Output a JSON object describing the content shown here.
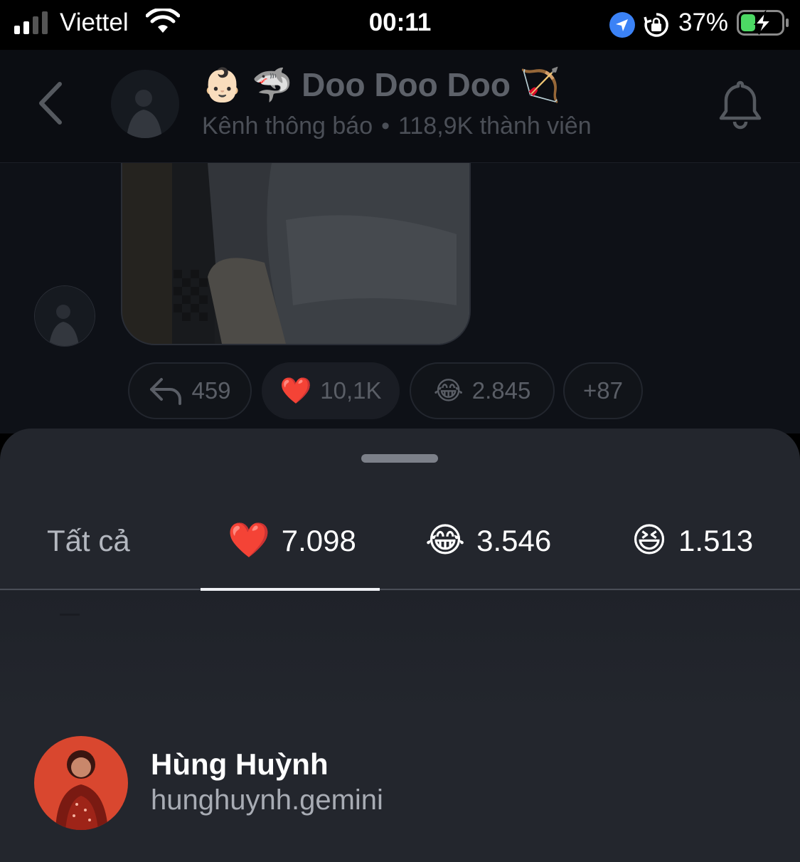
{
  "status_bar": {
    "carrier": "Viettel",
    "time": "00:11",
    "battery_percent": "37%",
    "battery_level": 0.37,
    "charging": true
  },
  "header": {
    "title_emoji_1": "👶🏻",
    "title_emoji_2": "🦈",
    "title_text": "Doo Doo Doo",
    "title_emoji_3": "🏹",
    "subtitle_type": "Kênh thông báo",
    "subtitle_separator": "•",
    "subtitle_members": "118,9K thành viên"
  },
  "message_reactions": [
    {
      "icon": "reply-icon",
      "count": "459"
    },
    {
      "emoji": "❤️",
      "count": "10,1K"
    },
    {
      "emoji": "😂",
      "count": "2.845"
    },
    {
      "count": "+87"
    }
  ],
  "sheet": {
    "tabs": [
      {
        "label": "Tất cả"
      },
      {
        "emoji": "❤️",
        "count": "7.098",
        "active": true
      },
      {
        "emoji": "😂",
        "count": "3.546"
      },
      {
        "emoji": "😆",
        "count": "1.513"
      }
    ],
    "users": [
      {
        "name": "Hùng Huỳnh",
        "handle": "hunghuynh.gemini"
      }
    ]
  },
  "colors": {
    "sheet_bg": "#23262d",
    "header_bg": "#0b0d12",
    "tab_indicator": "#eef0f4",
    "avatar_accent": "#d9472f"
  }
}
